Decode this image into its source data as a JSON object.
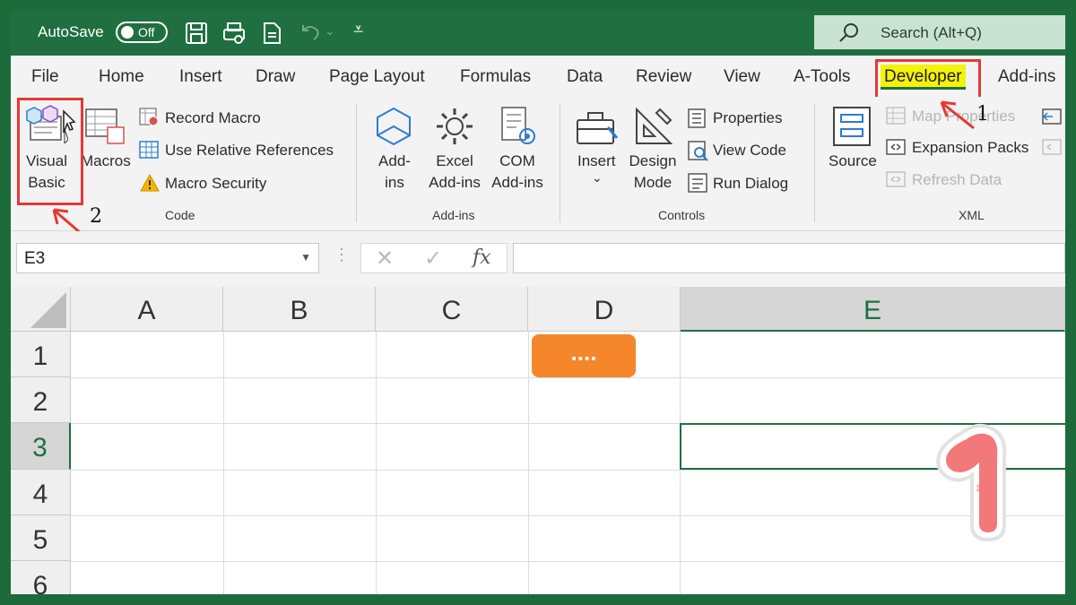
{
  "titlebar": {
    "autosave_label": "AutoSave",
    "autosave_state": "Off",
    "search_placeholder": "Search (Alt+Q)"
  },
  "tabs": [
    "File",
    "Home",
    "Insert",
    "Draw",
    "Page Layout",
    "Formulas",
    "Data",
    "Review",
    "View",
    "A-Tools",
    "Developer",
    "Add-ins"
  ],
  "active_tab": "Developer",
  "ribbon": {
    "code": {
      "visual_basic": "Visual\nBasic",
      "macros": "Macros",
      "record_macro": "Record Macro",
      "use_relative": "Use Relative References",
      "macro_security": "Macro Security",
      "label": "Code"
    },
    "addins": {
      "addins": "Add-\nins",
      "excel_addins": "Excel\nAdd-ins",
      "com_addins": "COM\nAdd-ins",
      "label": "Add-ins"
    },
    "controls": {
      "insert": "Insert",
      "insert_caret": "⌄",
      "design_mode": "Design\nMode",
      "properties": "Properties",
      "view_code": "View Code",
      "run_dialog": "Run Dialog",
      "label": "Controls"
    },
    "xml": {
      "source": "Source",
      "map_properties": "Map Properties",
      "expansion_packs": "Expansion Packs",
      "refresh_data": "Refresh Data",
      "label": "XML"
    }
  },
  "formula_bar": {
    "name_box": "E3",
    "fx": "fx",
    "value": ""
  },
  "grid": {
    "columns": [
      "A",
      "B",
      "C",
      "D",
      "E"
    ],
    "rows": [
      "1",
      "2",
      "3",
      "4",
      "5",
      "6"
    ],
    "active_column": "E",
    "active_row": "3",
    "active_cell": "E3",
    "button_label": "...."
  },
  "annotations": {
    "step1": "1",
    "step2": "2",
    "badge": "1"
  },
  "colors": {
    "excel_green": "#1f6f41",
    "highlight_yellow": "#f5f20a",
    "annotation_red": "#e53935",
    "button_orange": "#f5862a",
    "badge_pink": "#f2787a"
  }
}
